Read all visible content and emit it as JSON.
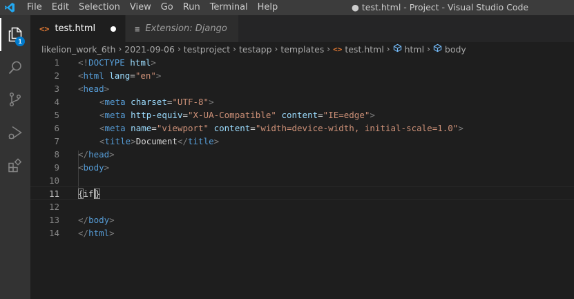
{
  "menu": [
    "File",
    "Edit",
    "Selection",
    "View",
    "Go",
    "Run",
    "Terminal",
    "Help"
  ],
  "window_title": "● test.html - Project - Visual Studio Code",
  "activity_bar": {
    "explorer_badge": "1",
    "items": [
      "explorer",
      "search",
      "source-control",
      "run-debug",
      "extensions"
    ]
  },
  "tabs": [
    {
      "label": "test.html",
      "icon": "<>",
      "dirty": true,
      "active": true
    },
    {
      "label": "Extension: Django",
      "icon": "≡",
      "italic": true
    }
  ],
  "breadcrumb": [
    "likelion_work_6th",
    "2021-09-06",
    "testproject",
    "testapp",
    "templates",
    "test.html",
    "html",
    "body"
  ],
  "editor": {
    "line_numbers": [
      "1",
      "2",
      "3",
      "4",
      "5",
      "6",
      "7",
      "8",
      "9",
      "10",
      "11",
      "12",
      "13",
      "14"
    ],
    "current_line": "11",
    "code": {
      "l1a": "<!",
      "l1b": "DOCTYPE",
      "l1c": " ",
      "l1d": "html",
      "l1e": ">",
      "l2a": "<",
      "l2b": "html",
      "l2c": " ",
      "l2d": "lang",
      "l2e": "=",
      "l2f": "\"en\"",
      "l2g": ">",
      "l3a": "<",
      "l3b": "head",
      "l3c": ">",
      "l4a": "<",
      "l4b": "meta",
      "l4c": " ",
      "l4d": "charset",
      "l4e": "=",
      "l4f": "\"UTF-8\"",
      "l4g": ">",
      "l5a": "<",
      "l5b": "meta",
      "l5c": " ",
      "l5d": "http-equiv",
      "l5e": "=",
      "l5f": "\"X-UA-Compatible\"",
      "l5g": " ",
      "l5h": "content",
      "l5i": "=",
      "l5j": "\"IE=edge\"",
      "l5k": ">",
      "l6a": "<",
      "l6b": "meta",
      "l6c": " ",
      "l6d": "name",
      "l6e": "=",
      "l6f": "\"viewport\"",
      "l6g": " ",
      "l6h": "content",
      "l6i": "=",
      "l6j": "\"width=device-width, initial-scale=1.0\"",
      "l6k": ">",
      "l7a": "<",
      "l7b": "title",
      "l7c": ">",
      "l7d": "Document",
      "l7e": "</",
      "l7f": "title",
      "l7g": ">",
      "l8a": "</",
      "l8b": "head",
      "l8c": ">",
      "l9a": "<",
      "l9b": "body",
      "l9c": ">",
      "l11a": "{",
      "l11b": "if",
      "l11c": "}",
      "l13a": "</",
      "l13b": "body",
      "l13c": ">",
      "l14a": "</",
      "l14b": "html",
      "l14c": ">"
    }
  },
  "colors": {
    "accent": "#007acc",
    "tag": "#569cd6",
    "attribute": "#9cdcfe",
    "string": "#ce9178",
    "html_icon": "#e37933"
  }
}
